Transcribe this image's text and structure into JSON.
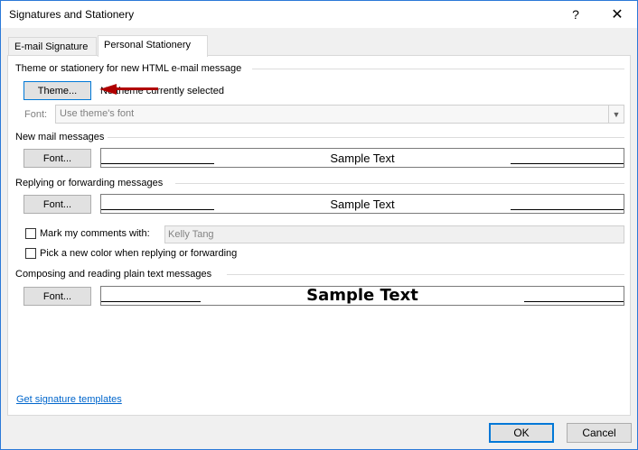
{
  "window": {
    "title": "Signatures and Stationery",
    "help_glyph": "?",
    "close_glyph": "✕"
  },
  "tabs": [
    {
      "label": "E-mail Signature",
      "active": false
    },
    {
      "label": "Personal Stationery",
      "active": true
    }
  ],
  "theme_section": {
    "heading": "Theme or stationery for new HTML e-mail message",
    "theme_button": "Theme...",
    "status": "No theme currently selected",
    "font_label": "Font:",
    "font_value": "Use theme's font"
  },
  "new_mail": {
    "heading": "New mail messages",
    "font_button": "Font...",
    "sample": "Sample Text"
  },
  "reply": {
    "heading": "Replying or forwarding messages",
    "font_button": "Font...",
    "sample": "Sample Text",
    "mark_comments_label": "Mark my comments with:",
    "mark_comments_value": "Kelly Tang",
    "pick_color_label": "Pick a new color when replying or forwarding"
  },
  "plain_text": {
    "heading": "Composing and reading plain text messages",
    "font_button": "Font...",
    "sample": "Sample Text"
  },
  "link": "Get signature templates",
  "footer": {
    "ok": "OK",
    "cancel": "Cancel"
  },
  "colors": {
    "annotation_arrow": "#b00000",
    "focus_border": "#0078d7",
    "link": "#0066cc"
  }
}
